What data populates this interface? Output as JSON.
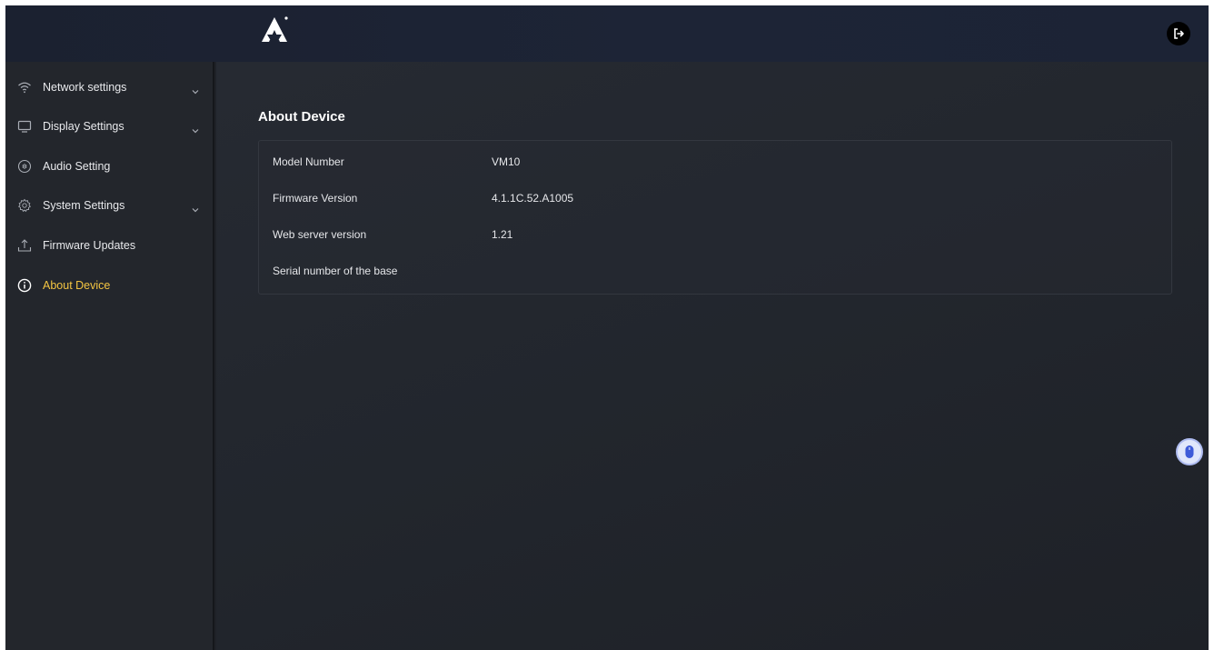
{
  "header": {
    "logo_icon": "brand-logo-icon",
    "logout_icon": "logout-icon"
  },
  "sidebar": {
    "items": [
      {
        "label": "Network settings",
        "icon": "wifi-icon",
        "has_chevron": true,
        "active": false
      },
      {
        "label": "Display Settings",
        "icon": "monitor-icon",
        "has_chevron": true,
        "active": false
      },
      {
        "label": "Audio Setting",
        "icon": "audio-icon",
        "has_chevron": false,
        "active": false
      },
      {
        "label": "System Settings",
        "icon": "gear-icon",
        "has_chevron": true,
        "active": false
      },
      {
        "label": "Firmware Updates",
        "icon": "upload-icon",
        "has_chevron": false,
        "active": false
      },
      {
        "label": "About Device",
        "icon": "info-icon",
        "has_chevron": false,
        "active": true
      }
    ]
  },
  "main": {
    "title": "About Device",
    "rows": [
      {
        "key": "Model Number",
        "value": "VM10"
      },
      {
        "key": "Firmware Version",
        "value": "4.1.1C.52.A1005"
      },
      {
        "key": "Web server version",
        "value": "1.21"
      },
      {
        "key": "Serial number of the base",
        "value": ""
      }
    ]
  },
  "colors": {
    "active_accent": "#f4c542",
    "background": "#1f2228",
    "topbar": "#1c2335"
  }
}
